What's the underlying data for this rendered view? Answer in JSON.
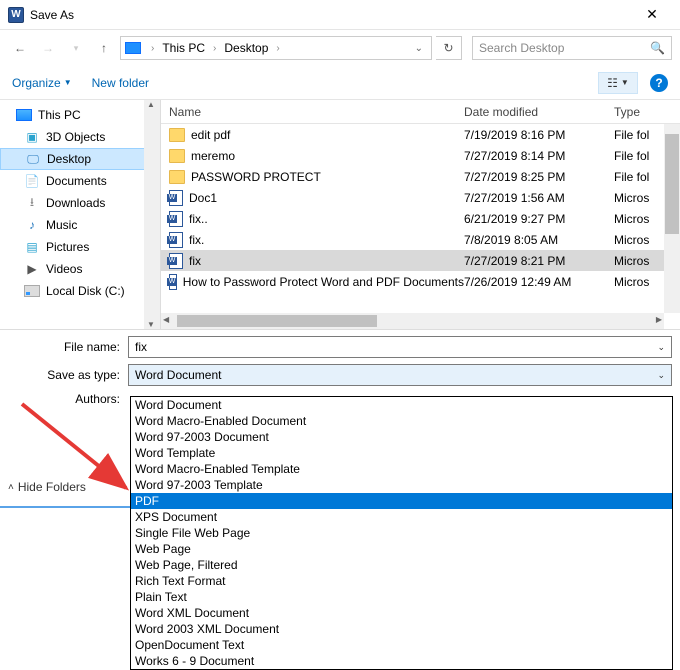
{
  "title": "Save As",
  "nav": {
    "crumb1": "This PC",
    "crumb2": "Desktop",
    "search_placeholder": "Search Desktop"
  },
  "toolbar": {
    "organize": "Organize",
    "newfolder": "New folder"
  },
  "tree": {
    "root": "This PC",
    "items": [
      "3D Objects",
      "Desktop",
      "Documents",
      "Downloads",
      "Music",
      "Pictures",
      "Videos",
      "Local Disk (C:)"
    ]
  },
  "columns": {
    "name": "Name",
    "date": "Date modified",
    "type": "Type"
  },
  "files": [
    {
      "icon": "folder",
      "name": "edit pdf",
      "date": "7/19/2019 8:16 PM",
      "type": "File fol"
    },
    {
      "icon": "folder",
      "name": "meremo",
      "date": "7/27/2019 8:14 PM",
      "type": "File fol"
    },
    {
      "icon": "folder",
      "name": "PASSWORD PROTECT",
      "date": "7/27/2019 8:25 PM",
      "type": "File fol"
    },
    {
      "icon": "wdoc",
      "name": "Doc1",
      "date": "7/27/2019 1:56 AM",
      "type": "Micros"
    },
    {
      "icon": "wdoc",
      "name": "fix..",
      "date": "6/21/2019 9:27 PM",
      "type": "Micros"
    },
    {
      "icon": "wdoc",
      "name": "fix.",
      "date": "7/8/2019 8:05 AM",
      "type": "Micros"
    },
    {
      "icon": "wdoc",
      "name": "fix",
      "date": "7/27/2019 8:21 PM",
      "type": "Micros",
      "selected": true
    },
    {
      "icon": "wdoc",
      "name": "How to Password Protect Word and PDF Documents",
      "date": "7/26/2019 12:49 AM",
      "type": "Micros"
    }
  ],
  "form": {
    "filename_label": "File name:",
    "filename_value": "fix",
    "saveastype_label": "Save as type:",
    "saveastype_value": "Word Document",
    "authors_label": "Authors:"
  },
  "dropdown": [
    "Word Document",
    "Word Macro-Enabled Document",
    "Word 97-2003 Document",
    "Word Template",
    "Word Macro-Enabled Template",
    "Word 97-2003 Template",
    "PDF",
    "XPS Document",
    "Single File Web Page",
    "Web Page",
    "Web Page, Filtered",
    "Rich Text Format",
    "Plain Text",
    "Word XML Document",
    "Word 2003 XML Document",
    "OpenDocument Text",
    "Works 6 - 9 Document"
  ],
  "dropdown_highlight": "PDF",
  "footer": {
    "hide_folders": "Hide Folders"
  }
}
